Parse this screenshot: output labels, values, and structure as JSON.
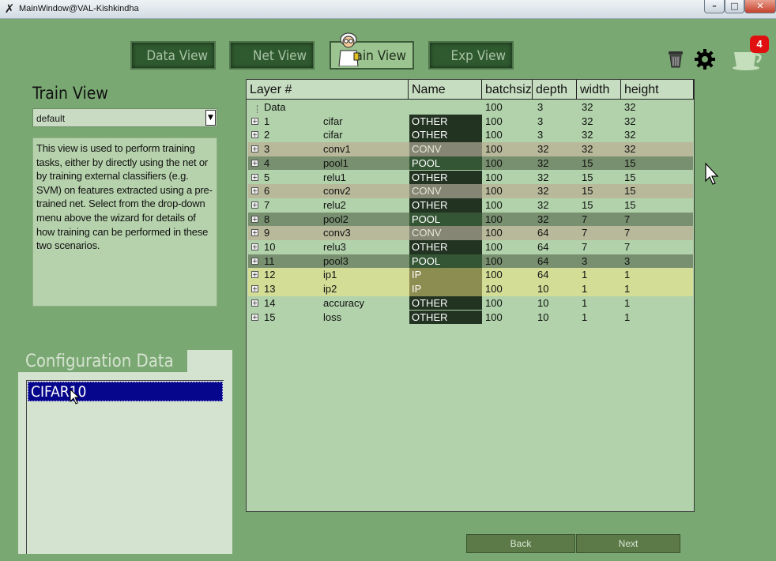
{
  "window": {
    "title": "MainWindow@VAL-Kishkindha",
    "minimize": "–",
    "maximize": "□",
    "close": "✕"
  },
  "nav": {
    "data_view": "Data View",
    "net_view": "Net View",
    "train_view": "Train View",
    "exp_view": "Exp View"
  },
  "notifications": {
    "count": "4"
  },
  "left": {
    "title": "Train View",
    "dropdown_value": "default",
    "description": "This view is used to perform training tasks, either by directly using the net or by training external classifiers (e.g. SVM) on features extracted using a pre-trained net. Select from the drop-down menu above the wizard for details of how training can be performed in these two scenarios."
  },
  "config": {
    "title": "Configuration Data",
    "items": [
      "CIFAR10"
    ]
  },
  "table": {
    "headers": [
      "Layer #",
      "Name",
      "batchsiz",
      "depth",
      "width",
      "height"
    ],
    "data_row": {
      "label": "Data",
      "batch": "100",
      "depth": "3",
      "width": "32",
      "height": "32"
    },
    "rows": [
      {
        "idx": "1",
        "name": "cifar",
        "type": "OTHER",
        "batch": "100",
        "depth": "3",
        "width": "32",
        "height": "32"
      },
      {
        "idx": "2",
        "name": "cifar",
        "type": "OTHER",
        "batch": "100",
        "depth": "3",
        "width": "32",
        "height": "32"
      },
      {
        "idx": "3",
        "name": "conv1",
        "type": "CONV",
        "batch": "100",
        "depth": "32",
        "width": "32",
        "height": "32"
      },
      {
        "idx": "4",
        "name": "pool1",
        "type": "POOL",
        "batch": "100",
        "depth": "32",
        "width": "15",
        "height": "15"
      },
      {
        "idx": "5",
        "name": "relu1",
        "type": "OTHER",
        "batch": "100",
        "depth": "32",
        "width": "15",
        "height": "15"
      },
      {
        "idx": "6",
        "name": "conv2",
        "type": "CONV",
        "batch": "100",
        "depth": "32",
        "width": "15",
        "height": "15"
      },
      {
        "idx": "7",
        "name": "relu2",
        "type": "OTHER",
        "batch": "100",
        "depth": "32",
        "width": "15",
        "height": "15"
      },
      {
        "idx": "8",
        "name": "pool2",
        "type": "POOL",
        "batch": "100",
        "depth": "32",
        "width": "7",
        "height": "7"
      },
      {
        "idx": "9",
        "name": "conv3",
        "type": "CONV",
        "batch": "100",
        "depth": "64",
        "width": "7",
        "height": "7"
      },
      {
        "idx": "10",
        "name": "relu3",
        "type": "OTHER",
        "batch": "100",
        "depth": "64",
        "width": "7",
        "height": "7"
      },
      {
        "idx": "11",
        "name": "pool3",
        "type": "POOL",
        "batch": "100",
        "depth": "64",
        "width": "3",
        "height": "3"
      },
      {
        "idx": "12",
        "name": "ip1",
        "type": "IP",
        "batch": "100",
        "depth": "64",
        "width": "1",
        "height": "1"
      },
      {
        "idx": "13",
        "name": "ip2",
        "type": "IP",
        "batch": "100",
        "depth": "10",
        "width": "1",
        "height": "1"
      },
      {
        "idx": "14",
        "name": "accuracy",
        "type": "OTHER",
        "batch": "100",
        "depth": "10",
        "width": "1",
        "height": "1"
      },
      {
        "idx": "15",
        "name": "loss",
        "type": "OTHER",
        "batch": "100",
        "depth": "10",
        "width": "1",
        "height": "1"
      }
    ]
  },
  "type_colors": {
    "OTHER": {
      "row": "#b1d2aa",
      "cell": "#223322",
      "text": "#ffffff"
    },
    "CONV": {
      "row": "#b8b99a",
      "cell": "#868675",
      "text": "#e8e8d8"
    },
    "POOL": {
      "row": "#78906f",
      "cell": "#355635",
      "text": "#ffffff"
    },
    "IP": {
      "row": "#d3dd96",
      "cell": "#8c8d50",
      "text": "#ffffff"
    }
  },
  "buttons": {
    "back": "Back",
    "next": "Next"
  }
}
